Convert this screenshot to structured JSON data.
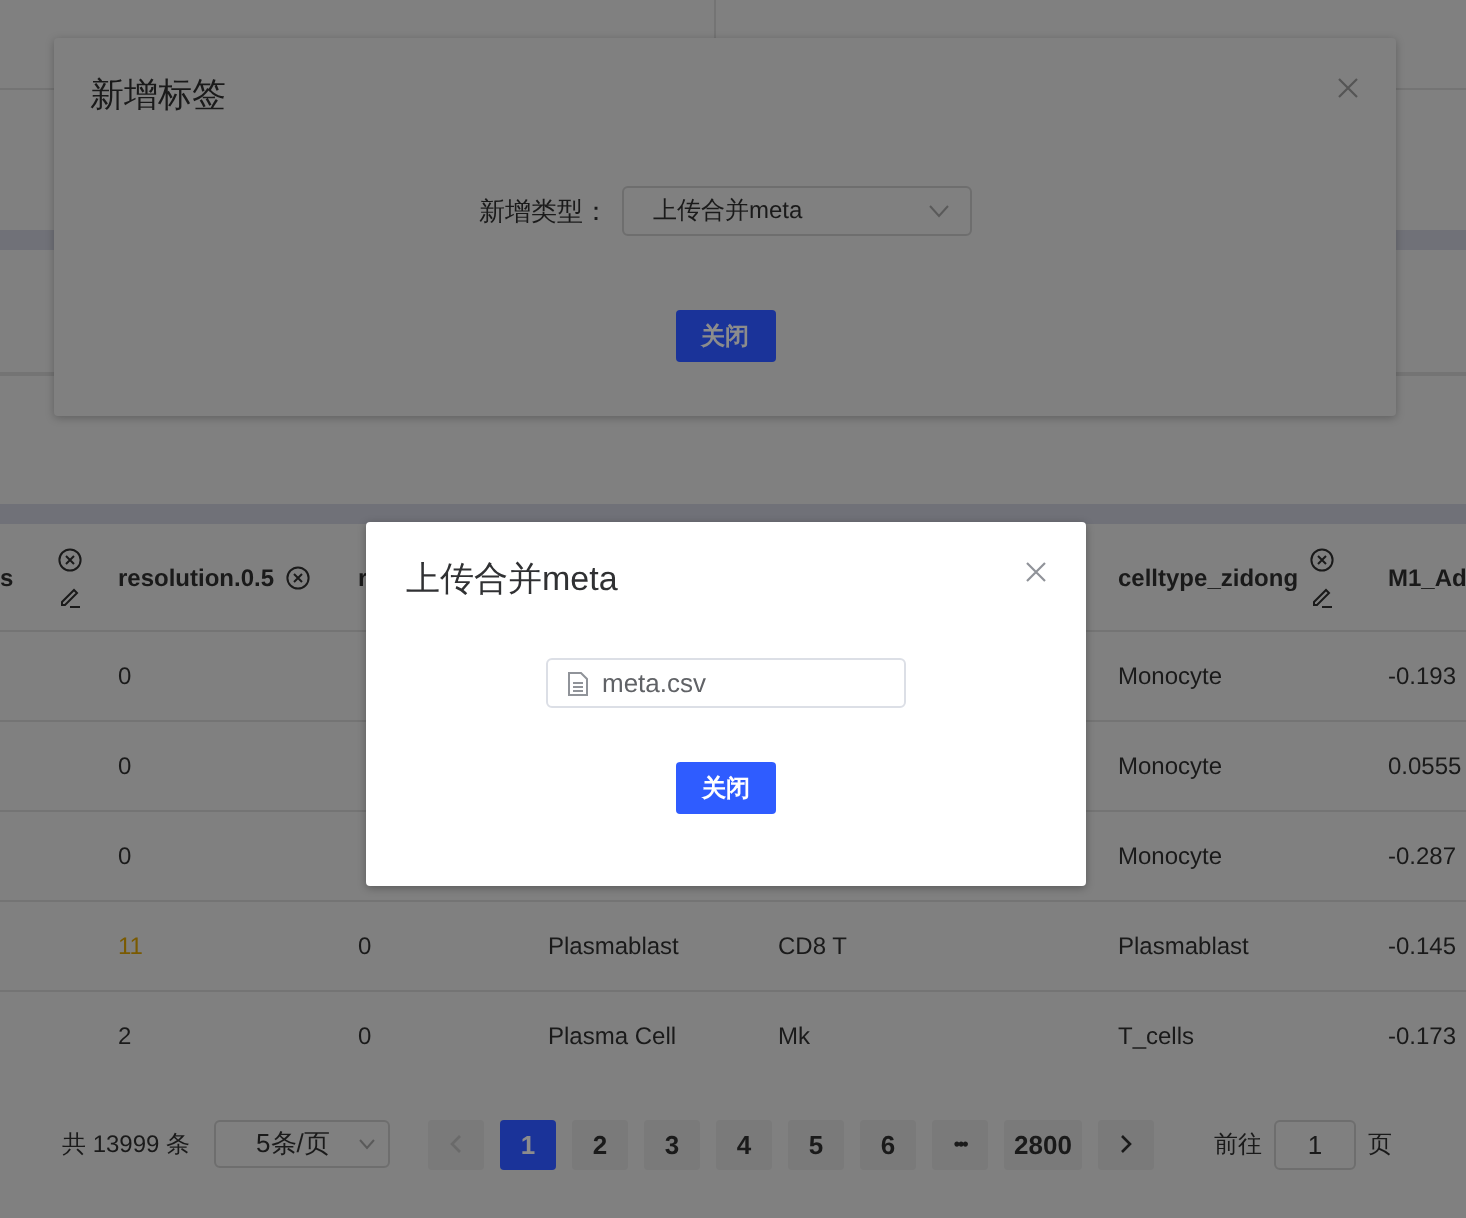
{
  "table": {
    "columns": [
      {
        "label": "s",
        "icons": [
          {
            "kind": "remove"
          },
          {
            "kind": "edit"
          }
        ]
      },
      {
        "label": "resolution.0.5",
        "icons": [
          {
            "kind": "remove"
          }
        ]
      },
      {
        "label": "r"
      },
      {},
      {},
      {
        "label": "celltype_zidong",
        "icons": [
          {
            "kind": "remove"
          },
          {
            "kind": "edit"
          }
        ]
      },
      {
        "label": "M1_Ad"
      }
    ],
    "rows": [
      {
        "highlight": false,
        "cells": [
          null,
          "0",
          null,
          null,
          null,
          "Monocyte",
          "-0.193"
        ]
      },
      {
        "highlight": false,
        "cells": [
          null,
          "0",
          null,
          null,
          null,
          "Monocyte",
          "0.0555"
        ]
      },
      {
        "highlight": false,
        "cells": [
          null,
          "0",
          null,
          null,
          null,
          "Monocyte",
          "-0.287"
        ]
      },
      {
        "highlight": true,
        "cells": [
          null,
          "11",
          "0",
          "Plasmablast",
          "CD8 T",
          "Plasmablast",
          "-0.145"
        ]
      },
      {
        "highlight": false,
        "cells": [
          null,
          "2",
          "0",
          "Plasma Cell",
          "Mk",
          "T_cells",
          "-0.173"
        ]
      }
    ]
  },
  "pagination": {
    "total": "共 13999 条",
    "page_size": "5条/页",
    "prev_disabled": true,
    "next_disabled": false,
    "pages": [
      {
        "kind": "page",
        "label": "1",
        "selected": true
      },
      {
        "kind": "page",
        "label": "2",
        "selected": false
      },
      {
        "kind": "page",
        "label": "3",
        "selected": false
      },
      {
        "kind": "page",
        "label": "4",
        "selected": false
      },
      {
        "kind": "page",
        "label": "5",
        "selected": false
      },
      {
        "kind": "page",
        "label": "6",
        "selected": false
      },
      {
        "kind": "more",
        "label": "•••",
        "selected": false
      },
      {
        "kind": "page",
        "label": "2800",
        "selected": false
      }
    ],
    "goto_label": "前往",
    "goto_value": "1",
    "goto_suffix": "页"
  },
  "dialogs": [
    {
      "kind": "select_form",
      "dimmed": true,
      "title": "新增标签",
      "field_label": "新增类型：",
      "select_value": "上传合并meta",
      "button": "关闭"
    },
    {
      "kind": "file_list",
      "dimmed": false,
      "title": "上传合并meta",
      "file": "meta.csv",
      "button": "关闭"
    }
  ]
}
